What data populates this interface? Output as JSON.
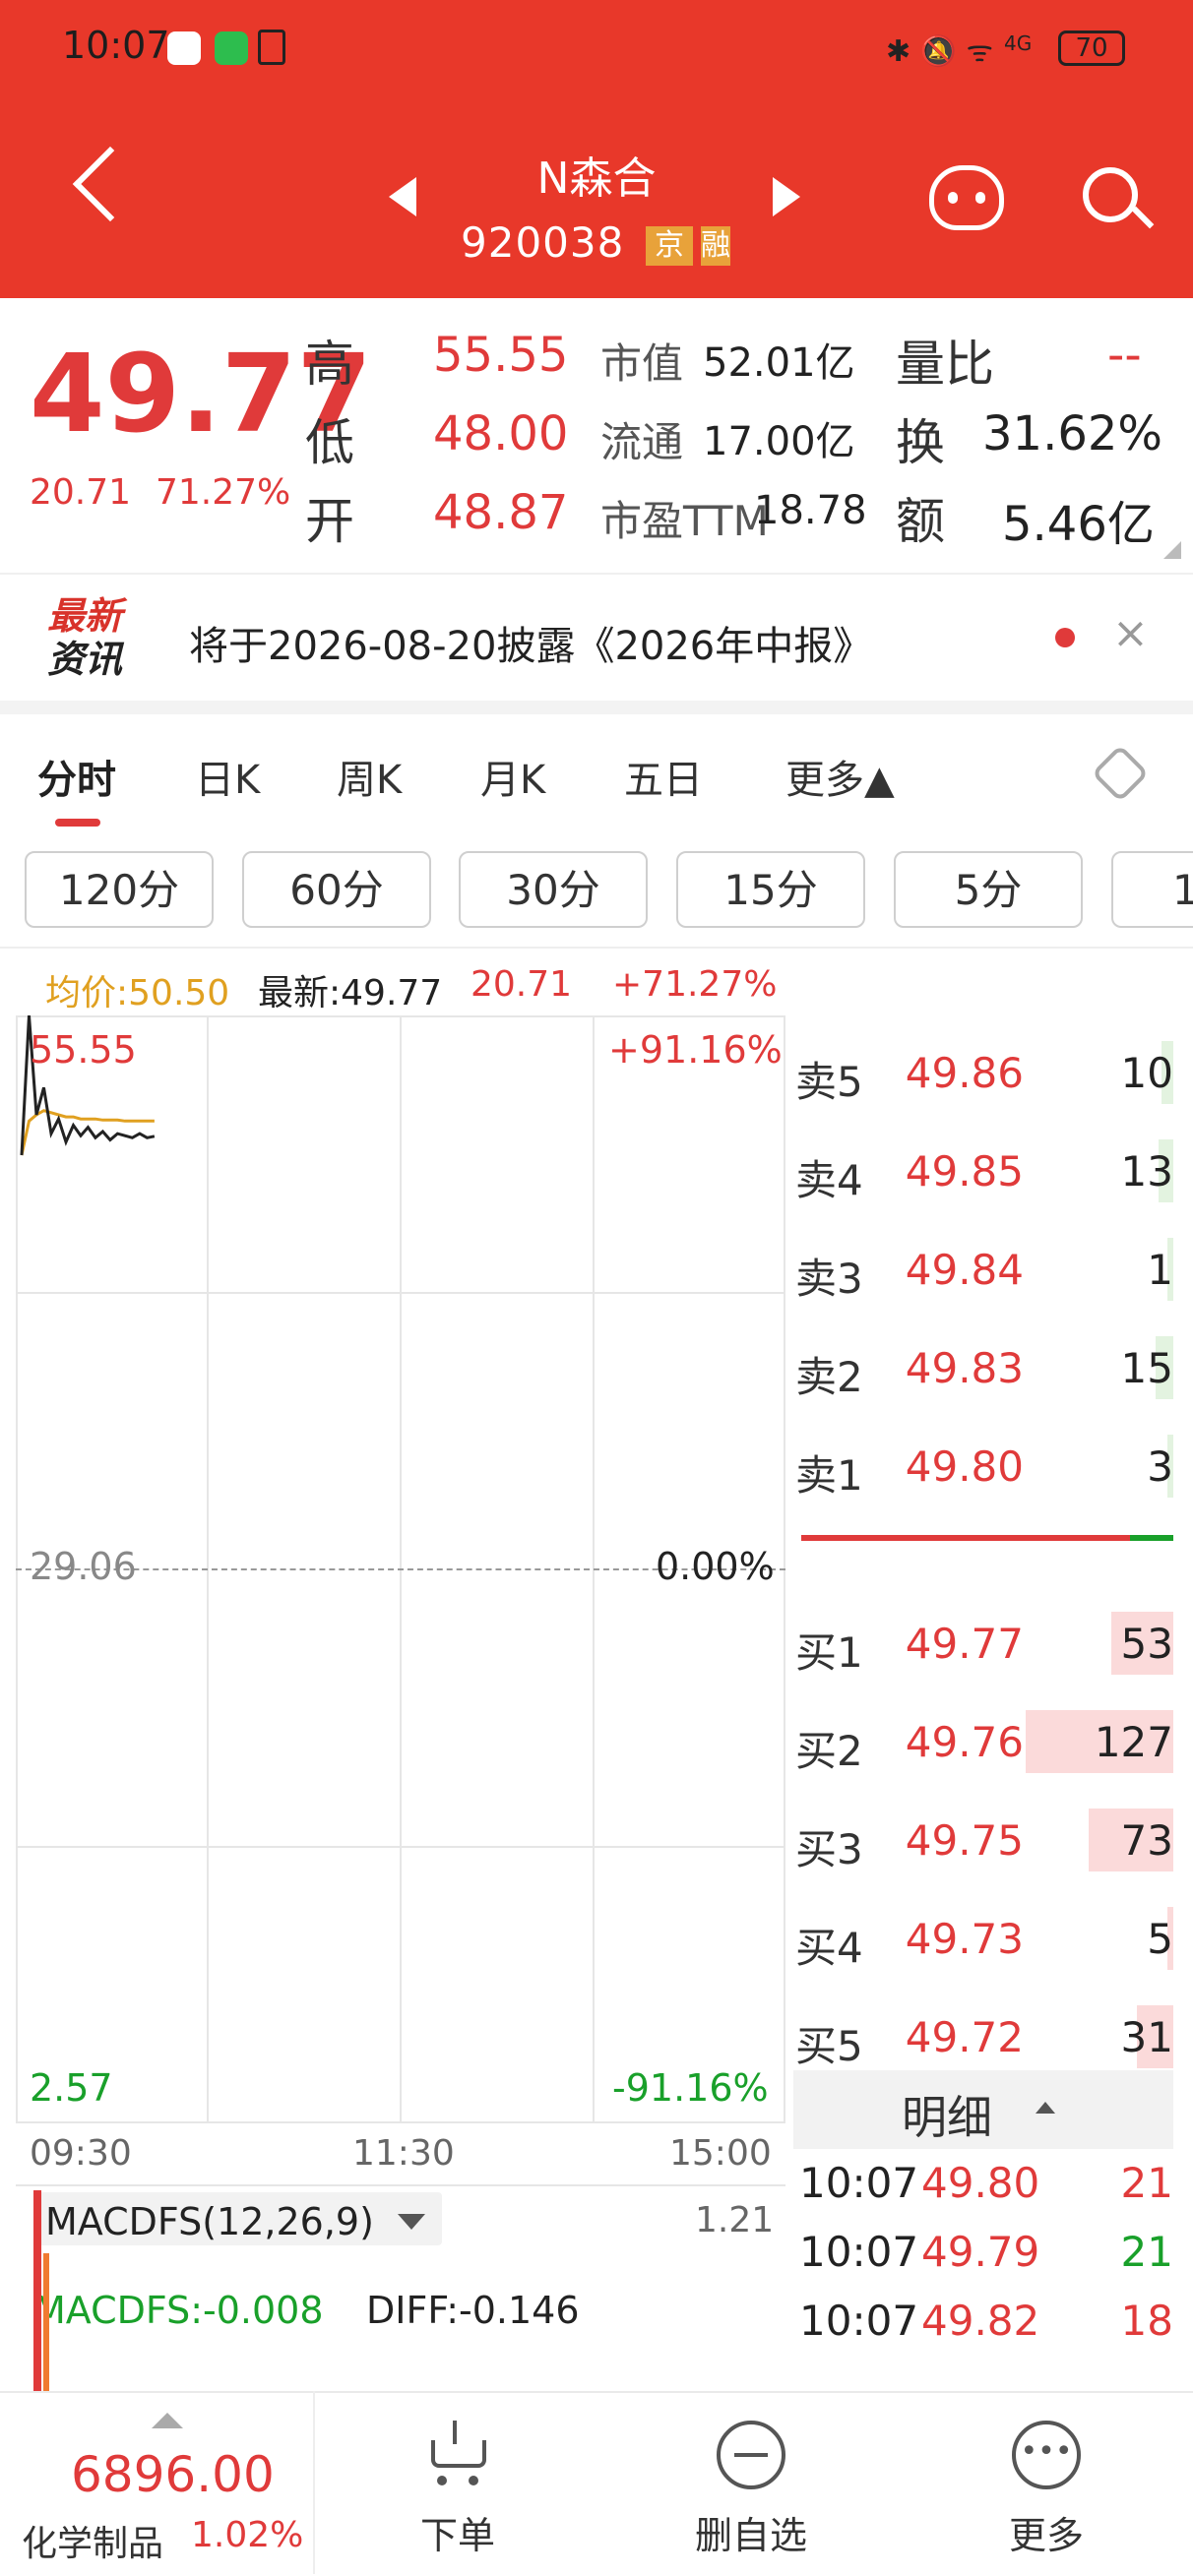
{
  "status_bar": {
    "time": "10:07",
    "battery": "70",
    "network": "4G"
  },
  "header": {
    "name": "N森合",
    "code": "920038",
    "badge1": "京",
    "badge2": "融"
  },
  "quote": {
    "price": "49.77",
    "change": "20.71",
    "change_pct": "71.27%",
    "high_label": "高",
    "high": "55.55",
    "low_label": "低",
    "low": "48.00",
    "open_label": "开",
    "open": "48.87",
    "mcap_label": "市值",
    "mcap": "52.01亿",
    "float_label": "流通",
    "float": "17.00亿",
    "pe_label": "市盈TTM",
    "pe": "18.78",
    "vr_label": "量比",
    "vr": "--",
    "turnover_label": "换",
    "turnover": "31.62%",
    "amount_label": "额",
    "amount": "5.46亿"
  },
  "news": {
    "logo_line1": "最新",
    "logo_line2": "资讯",
    "text": "将于2026-08-20披露《2026年中报》"
  },
  "tabs": [
    "分时",
    "日K",
    "周K",
    "月K",
    "五日",
    "更多▲"
  ],
  "periods": [
    "120分",
    "60分",
    "30分",
    "15分",
    "5分",
    "1"
  ],
  "legend": {
    "avg": "均价:50.50",
    "latest": "最新:49.77",
    "chg": "20.71",
    "pct": "+71.27%"
  },
  "chart": {
    "y_top": "55.55",
    "y_mid": "29.06",
    "y_bot": "2.57",
    "p_top": "+91.16%",
    "p_mid": "0.00%",
    "p_bot": "-91.16%",
    "t_start": "09:30",
    "t_mid": "11:30",
    "t_end": "15:00"
  },
  "chart_data": {
    "type": "line",
    "x": [
      "09:30",
      "09:31",
      "09:32",
      "09:33",
      "09:34",
      "09:35",
      "09:36",
      "09:37",
      "09:38",
      "09:39",
      "09:40",
      "09:41",
      "09:42",
      "09:43",
      "09:44",
      "09:45",
      "09:46",
      "09:47",
      "09:48"
    ],
    "series": [
      {
        "name": "price",
        "values": [
          48.87,
          55.55,
          50.8,
          52.1,
          49.9,
          50.6,
          49.5,
          50.3,
          49.8,
          50.2,
          49.7,
          50.0,
          49.6,
          49.9,
          49.8,
          49.7,
          49.9,
          49.7,
          49.77
        ]
      },
      {
        "name": "avg",
        "values": [
          48.87,
          50.5,
          50.8,
          51.0,
          50.9,
          50.8,
          50.7,
          50.7,
          50.6,
          50.6,
          50.6,
          50.55,
          50.55,
          50.55,
          50.5,
          50.5,
          50.5,
          50.5,
          50.5
        ]
      }
    ],
    "ylim": [
      2.57,
      55.55
    ],
    "grid": true
  },
  "orderbook": {
    "asks": [
      {
        "label": "卖5",
        "price": "49.86",
        "vol": "10"
      },
      {
        "label": "卖4",
        "price": "49.85",
        "vol": "13"
      },
      {
        "label": "卖3",
        "price": "49.84",
        "vol": "1"
      },
      {
        "label": "卖2",
        "price": "49.83",
        "vol": "15"
      },
      {
        "label": "卖1",
        "price": "49.80",
        "vol": "3"
      }
    ],
    "bids": [
      {
        "label": "买1",
        "price": "49.77",
        "vol": "53"
      },
      {
        "label": "买2",
        "price": "49.76",
        "vol": "127"
      },
      {
        "label": "买3",
        "price": "49.75",
        "vol": "73"
      },
      {
        "label": "买4",
        "price": "49.73",
        "vol": "5"
      },
      {
        "label": "买5",
        "price": "49.72",
        "vol": "31"
      }
    ]
  },
  "detail": {
    "title": "明细",
    "rows": [
      {
        "time": "10:07",
        "price": "49.80",
        "vol": "21",
        "color": "#e03a3a"
      },
      {
        "time": "10:07",
        "price": "49.79",
        "vol": "21",
        "color": "#19a02a"
      },
      {
        "time": "10:07",
        "price": "49.82",
        "vol": "18",
        "color": "#e03a3a"
      }
    ]
  },
  "macd": {
    "name": "MACDFS(12,26,9)",
    "value": "1.21",
    "macdfs": "MACDFS:-0.008",
    "diff": "DIFF:-0.146"
  },
  "bottom": {
    "index_value": "6896.00",
    "index_name": "化学制品",
    "index_pct": "1.02%",
    "order": "下单",
    "remove": "删自选",
    "more": "更多"
  }
}
